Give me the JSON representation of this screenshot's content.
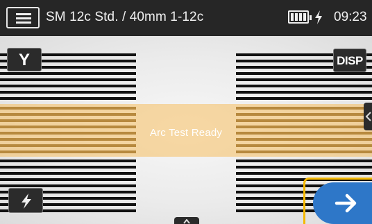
{
  "header": {
    "title": "SM 12c Std. / 40mm 1-12c",
    "time": "09:23",
    "menu_icon": "hamburger-menu-icon",
    "battery_icon": "battery-full-icon",
    "charging_icon": "lightning-charge-icon"
  },
  "view": {
    "status_text": "Arc Test Ready",
    "y_button_label": "Y",
    "disp_button_label": "DISP",
    "arc_button_icon": "lightning-bolt-icon",
    "next_button_icon": "arrow-right-icon",
    "side_tab_icon": "chevron-left-icon",
    "bottom_tab_icon": "chevron-up-icon"
  },
  "colors": {
    "status_bar": "#262626",
    "arc_band": "#f5be5f",
    "next_button": "#2e77c8",
    "highlight": "#f5b800"
  }
}
